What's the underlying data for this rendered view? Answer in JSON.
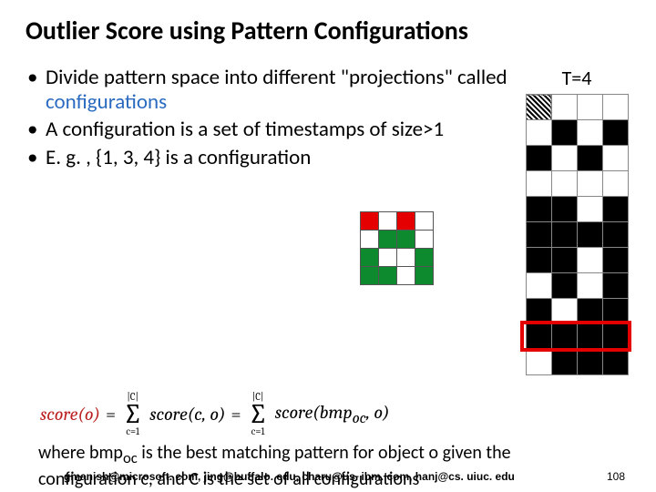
{
  "title": "Outlier Score using Pattern Configurations",
  "bullets": {
    "b1a": "Divide pattern space into different \"projections\" called ",
    "b1b": "configurations",
    "b2": "A configuration is a set of timestamps of size>1",
    "b3": "E. g. , {1, 3, 4} is a configuration"
  },
  "right": {
    "label": "T=4"
  },
  "big_grid": [
    "h...",
    ".k.k",
    "k.k.",
    "....",
    "kk.k",
    "kkkk",
    "kk.k",
    ".k.k",
    "k.kk",
    "kkkk",
    ".kkk"
  ],
  "mini_grid": [
    "r.r.",
    ".gg.",
    "g..g",
    "gg.g"
  ],
  "formula": {
    "lhs": "score(o)",
    "eq1": "=",
    "sum_top": "|C|",
    "sum_bot": "c=1",
    "mid": "score(c, o)",
    "eq2": "=",
    "rhs": "score(bmp",
    "sub": "oc",
    "rhs2": ", o)"
  },
  "caption_a": "where bmp",
  "caption_sub": "oc",
  "caption_b": " is the best matching pattern for object o given the configuration c, and C is the set of all configurations",
  "footer": {
    "emails": "gmanish@microsoft. com, jing@buffalo. edu, charu@us. ibm. com, hanj@cs. uiuc. edu",
    "page": "108"
  }
}
